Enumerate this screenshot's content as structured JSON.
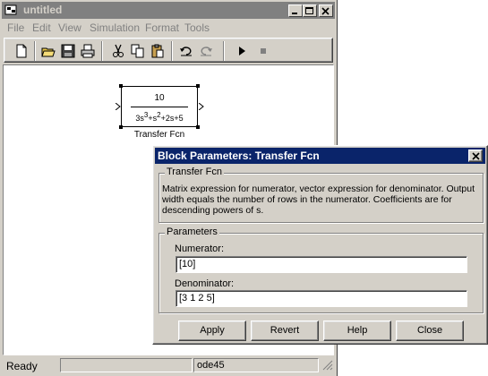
{
  "window": {
    "title": "untitled",
    "menu": [
      "File",
      "Edit",
      "View",
      "Simulation",
      "Format",
      "Tools"
    ]
  },
  "toolbar": {
    "icons": [
      "new-icon",
      "open-icon",
      "save-icon",
      "print-icon",
      "cut-icon",
      "copy-icon",
      "paste-icon",
      "undo-icon",
      "redo-icon",
      "play-icon",
      "stop-icon"
    ]
  },
  "block": {
    "numerator": "10",
    "denominator_parts": [
      "3s",
      "3",
      "+s",
      "2",
      "+2s+5"
    ],
    "name": "Transfer Fcn"
  },
  "status": {
    "ready": "Ready",
    "solver": "ode45"
  },
  "dialog": {
    "title": "Block Parameters: Transfer Fcn",
    "group1_label": "Transfer Fcn",
    "description": "Matrix expression for numerator, vector expression for denominator.  Output width equals the number of rows in the numerator.  Coefficients are for descending powers of s.",
    "group2_label": "Parameters",
    "numerator_label": "Numerator:",
    "numerator_value": "[10]",
    "denominator_label": "Denominator:",
    "denominator_value": "[3 1 2 5]",
    "buttons": {
      "apply": "Apply",
      "revert": "Revert",
      "help": "Help",
      "close": "Close"
    }
  },
  "colors": {
    "title_active": "#0a246a",
    "title_inactive": "#808080",
    "face": "#d4d0c8"
  }
}
